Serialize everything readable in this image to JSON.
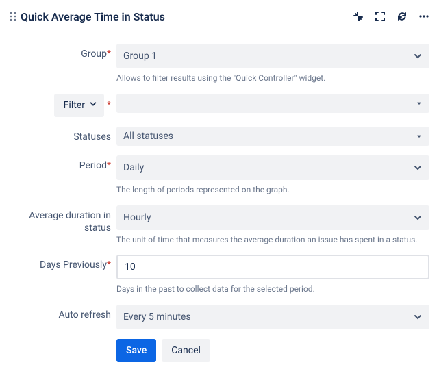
{
  "header": {
    "title": "Quick Average Time in Status"
  },
  "form": {
    "group": {
      "label": "Group",
      "value": "Group 1",
      "helper": "Allows to filter results using the \"Quick Controller\" widget."
    },
    "filter": {
      "label": "Filter",
      "value": ""
    },
    "statuses": {
      "label": "Statuses",
      "value": "All statuses"
    },
    "period": {
      "label": "Period",
      "value": "Daily",
      "helper": "The length of periods represented on the graph."
    },
    "avgDuration": {
      "label": "Average duration in status",
      "value": "Hourly",
      "helper": "The unit of time that measures the average duration an issue has spent in a status."
    },
    "daysPrev": {
      "label": "Days Previously",
      "value": "10",
      "helper": "Days in the past to collect data for the selected period."
    },
    "autoRefresh": {
      "label": "Auto refresh",
      "value": "Every 5 minutes"
    }
  },
  "actions": {
    "save": "Save",
    "cancel": "Cancel"
  }
}
